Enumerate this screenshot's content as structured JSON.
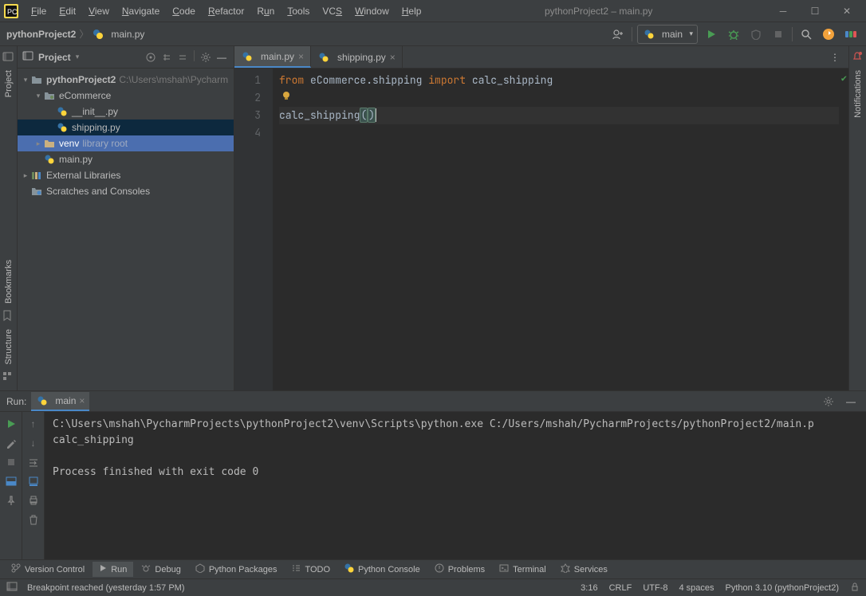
{
  "window": {
    "title": "pythonProject2 – main.py"
  },
  "menu": [
    "File",
    "Edit",
    "View",
    "Navigate",
    "Code",
    "Refactor",
    "Run",
    "Tools",
    "VCS",
    "Window",
    "Help"
  ],
  "breadcrumb": {
    "project": "pythonProject2",
    "file": "main.py"
  },
  "run_config": {
    "name": "main"
  },
  "project_panel": {
    "title": "Project",
    "root": {
      "name": "pythonProject2",
      "hint": "C:\\Users\\mshah\\Pycharm"
    },
    "ecommerce": {
      "name": "eCommerce"
    },
    "init_py": "__init__.py",
    "shipping_py": "shipping.py",
    "venv": {
      "name": "venv",
      "hint": "library root"
    },
    "main_py": "main.py",
    "ext_lib": "External Libraries",
    "scratches": "Scratches and Consoles"
  },
  "tabs": [
    {
      "name": "main.py",
      "active": true
    },
    {
      "name": "shipping.py",
      "active": false
    }
  ],
  "code": {
    "line1_kw_from": "from",
    "line1_pkg": "eCommerce.shipping",
    "line1_kw_import": "import",
    "line1_name": "calc_shipping",
    "line3_call": "calc_shipping",
    "line3_parens_open": "(",
    "line3_parens_close": ")"
  },
  "line_numbers": [
    "1",
    "2",
    "3",
    "4"
  ],
  "run": {
    "label": "Run:",
    "tab": "main",
    "console_line1": "C:\\Users\\mshah\\PycharmProjects\\pythonProject2\\venv\\Scripts\\python.exe C:/Users/mshah/PycharmProjects/pythonProject2/main.p",
    "console_line2": "calc_shipping",
    "console_line3": "",
    "console_line4": "Process finished with exit code 0"
  },
  "bottom_tools": {
    "version_control": "Version Control",
    "run": "Run",
    "debug": "Debug",
    "python_packages": "Python Packages",
    "todo": "TODO",
    "python_console": "Python Console",
    "problems": "Problems",
    "terminal": "Terminal",
    "services": "Services"
  },
  "status": {
    "message": "Breakpoint reached (yesterday 1:57 PM)",
    "pos": "3:16",
    "eol": "CRLF",
    "encoding": "UTF-8",
    "indent": "4 spaces",
    "interpreter": "Python 3.10 (pythonProject2)"
  },
  "sidebars": {
    "left_project": "Project",
    "left_bookmarks": "Bookmarks",
    "left_structure": "Structure",
    "right_notifications": "Notifications"
  }
}
